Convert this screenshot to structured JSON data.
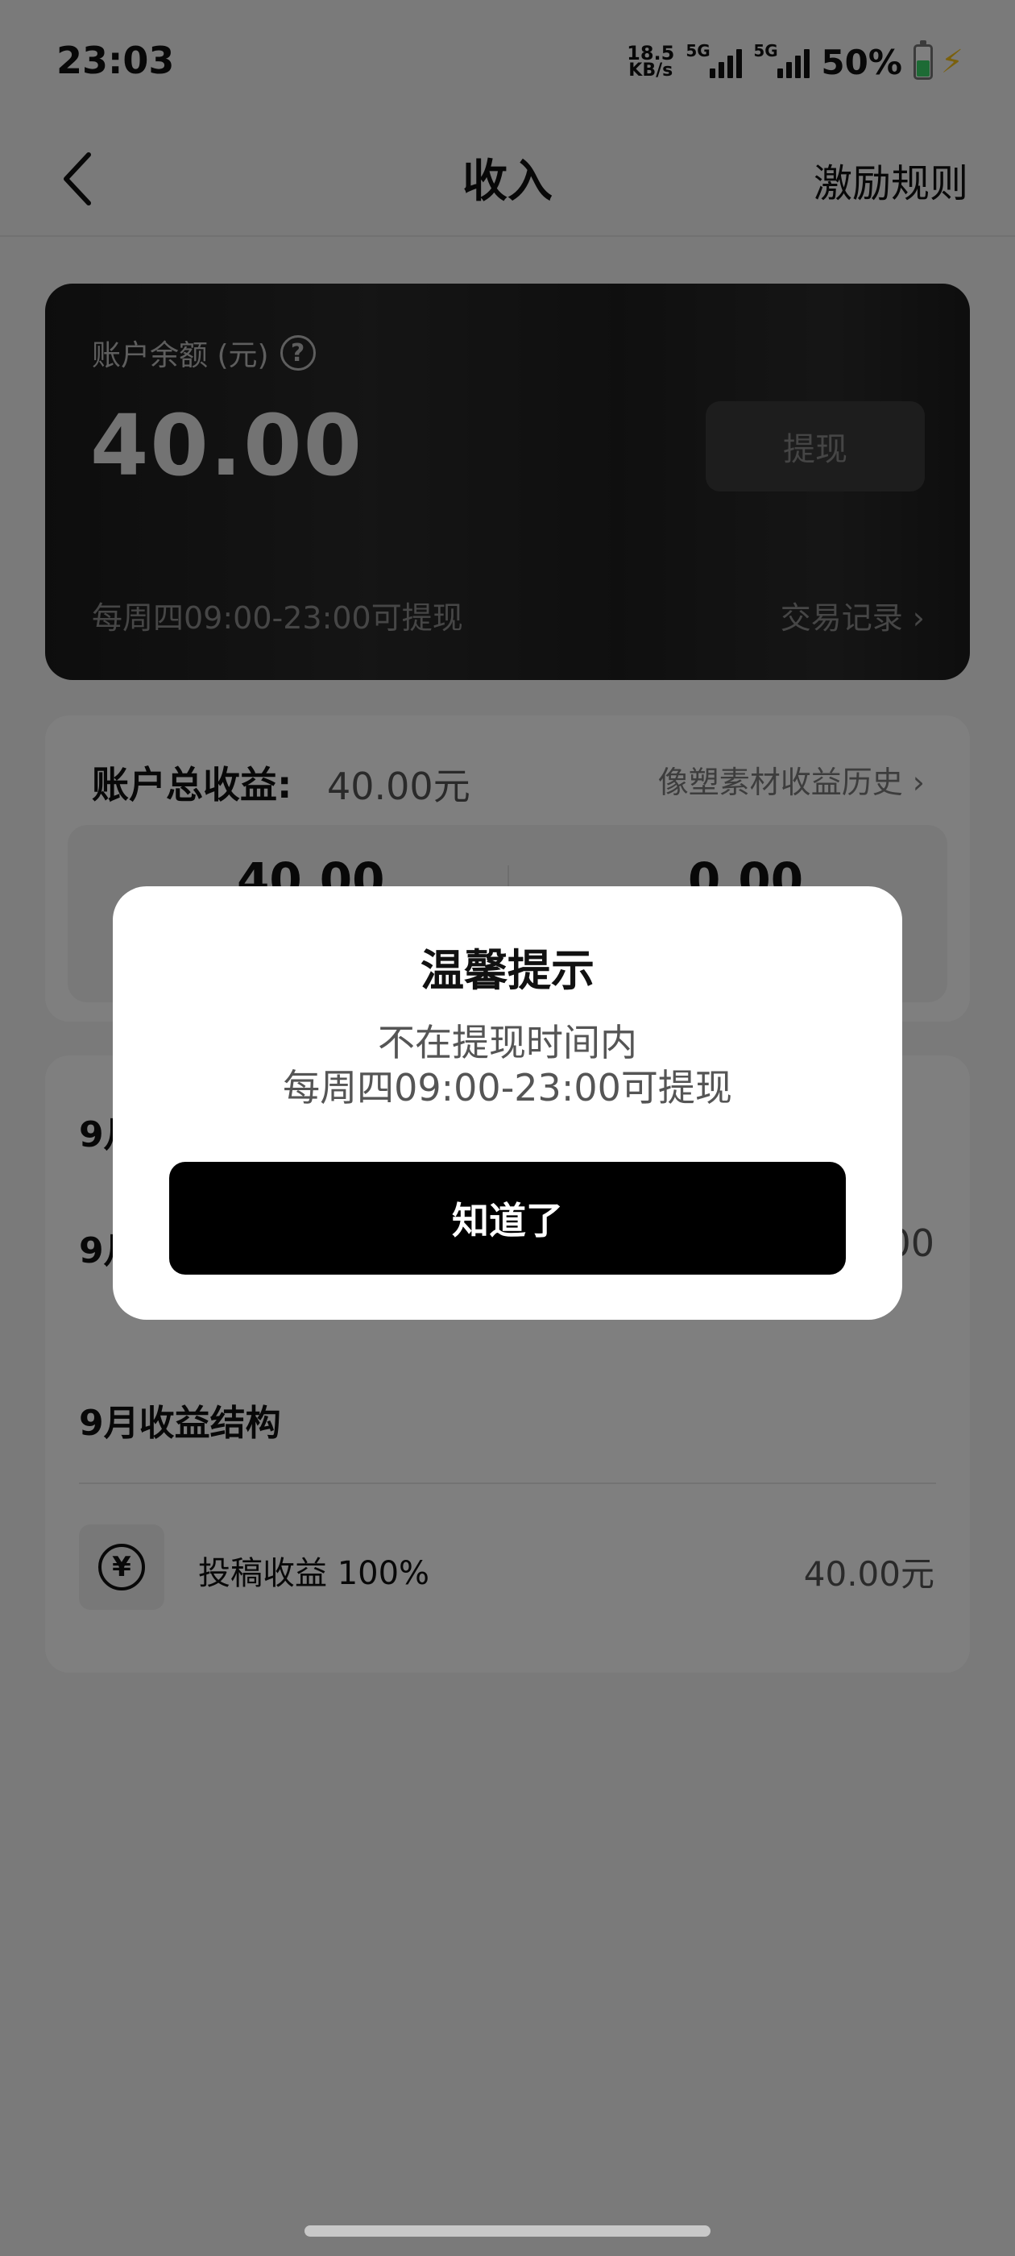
{
  "status_bar": {
    "time": "23:03",
    "net_speed_value": "18.5",
    "net_speed_unit": "KB/s",
    "signal1_label": "5G",
    "signal2_label": "5G",
    "battery_percent": "50%",
    "battery_color": "#3ad66a",
    "charging_color": "#f5c11b"
  },
  "nav": {
    "title": "收入",
    "rules_label": "激励规则",
    "back_icon": "chevron-left-icon"
  },
  "balance_card": {
    "label": "账户余额 (元)",
    "help_icon": "question-icon",
    "amount": "40.00",
    "withdraw_label": "提现",
    "hint": "每周四09:00-23:00可提现",
    "records_label": "交易记录 ›"
  },
  "earnings": {
    "title": "账户总收益:",
    "total": "40.00元",
    "history_label": "像塑素材收益历史 ›",
    "left_value": "40.00",
    "right_value": "0.00"
  },
  "month": {
    "row1_label": "9月",
    "row2_label": "9月",
    "row2_value": "00",
    "structure_title": "9月收益结构",
    "income_icon": "yen-icon",
    "income_label": "投稿收益 100%",
    "income_value": "40.00元"
  },
  "dialog": {
    "title": "温馨提示",
    "message_line1": "不在提现时间内",
    "message_line2": "每周四09:00-23:00可提现",
    "confirm_label": "知道了"
  }
}
